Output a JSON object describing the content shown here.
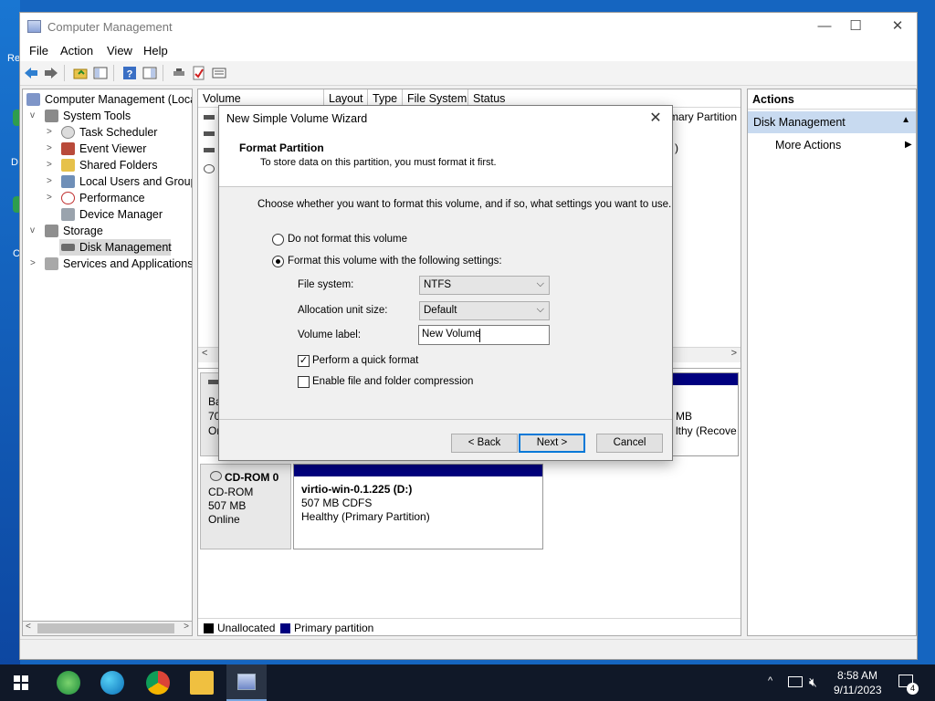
{
  "desktop": {
    "frag_re": "Re",
    "frag_d": "D",
    "frag_c": "C"
  },
  "window": {
    "title": "Computer Management",
    "controls": {
      "minimize": "—",
      "maximize": "☐",
      "close": "✕"
    }
  },
  "menu": {
    "file": "File",
    "action": "Action",
    "view": "View",
    "help": "Help"
  },
  "tree": {
    "root": "Computer Management (Local",
    "system_tools": "System Tools",
    "task_scheduler": "Task Scheduler",
    "event_viewer": "Event Viewer",
    "shared_folders": "Shared Folders",
    "local_users": "Local Users and Groups",
    "performance": "Performance",
    "device_manager": "Device Manager",
    "storage": "Storage",
    "disk_management": "Disk Management",
    "services": "Services and Applications"
  },
  "volume_list": {
    "columns": {
      "volume": "Volume",
      "layout": "Layout",
      "type": "Type",
      "file_system": "File System",
      "status": "Status"
    },
    "partial_primary": "mary Partition",
    "partial_paren": ")"
  },
  "graphical": {
    "disk0_frag_1": "Bas",
    "disk0_frag_2": "70.",
    "disk0_frag_3": "On",
    "disk0_right_1": "MB",
    "disk0_right_2": "lthy (Recove",
    "cdrom_name": "CD-ROM 0",
    "cdrom_type": "CD-ROM",
    "cdrom_size": "507 MB",
    "cdrom_status": "Online",
    "vol_name": "virtio-win-0.1.225  (D:)",
    "vol_size": "507 MB CDFS",
    "vol_health": "Healthy (Primary Partition)"
  },
  "legend": {
    "unallocated": "Unallocated",
    "primary": "Primary partition"
  },
  "actions": {
    "header": "Actions",
    "section": "Disk Management",
    "more": "More Actions"
  },
  "dialog": {
    "title": "New Simple Volume Wizard",
    "heading": "Format Partition",
    "subheading": "To store data on this partition, you must format it first.",
    "instruction": "Choose whether you want to format this volume, and if so, what settings you want to use.",
    "opt_no_format": "Do not format this volume",
    "opt_format": "Format this volume with the following settings:",
    "fs_label": "File system:",
    "fs_value": "NTFS",
    "alloc_label": "Allocation unit size:",
    "alloc_value": "Default",
    "vol_label": "Volume label:",
    "vol_value": "New Volume",
    "quick_format": "Perform a quick format",
    "compression": "Enable file and folder compression",
    "back": "< Back",
    "next": "Next >",
    "cancel": "Cancel"
  },
  "taskbar": {
    "time": "8:58 AM",
    "date": "9/11/2023",
    "notifications": "4"
  }
}
